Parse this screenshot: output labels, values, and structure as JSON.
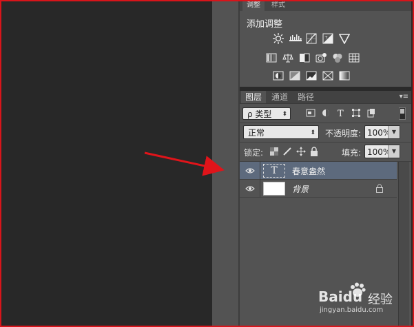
{
  "adjustments": {
    "tabs": [
      "调整",
      "样式"
    ],
    "title": "添加调整",
    "row1_icons": [
      "brightness-contrast-icon",
      "levels-icon",
      "curves-icon",
      "exposure-icon",
      "vibrance-icon"
    ],
    "row2_icons": [
      "hue-saturation-icon",
      "color-balance-icon",
      "black-white-icon",
      "photo-filter-icon",
      "channel-mixer-icon",
      "color-lookup-icon"
    ],
    "row3_icons": [
      "invert-icon",
      "posterize-icon",
      "threshold-icon",
      "selective-color-icon",
      "gradient-map-icon"
    ]
  },
  "layers_panel": {
    "tabs": [
      "图层",
      "通道",
      "路径"
    ],
    "menu": "▾≡",
    "filter_kind": "ρ 类型",
    "blend_mode": "正常",
    "opacity_label": "不透明度:",
    "opacity_value": "100%",
    "lock_label": "锁定:",
    "fill_label": "填充:",
    "fill_value": "100%",
    "layers": [
      {
        "name": "春意盎然",
        "thumb": "T",
        "selected": true
      },
      {
        "name": "背景",
        "locked": true
      }
    ]
  },
  "watermark": {
    "brand": "Baidu",
    "suffix": "经验",
    "url": "jingyan.baidu.com"
  },
  "colors": {
    "frame": "#d8141a",
    "arrow": "#e0141a",
    "selection": "#5d6a7d"
  }
}
